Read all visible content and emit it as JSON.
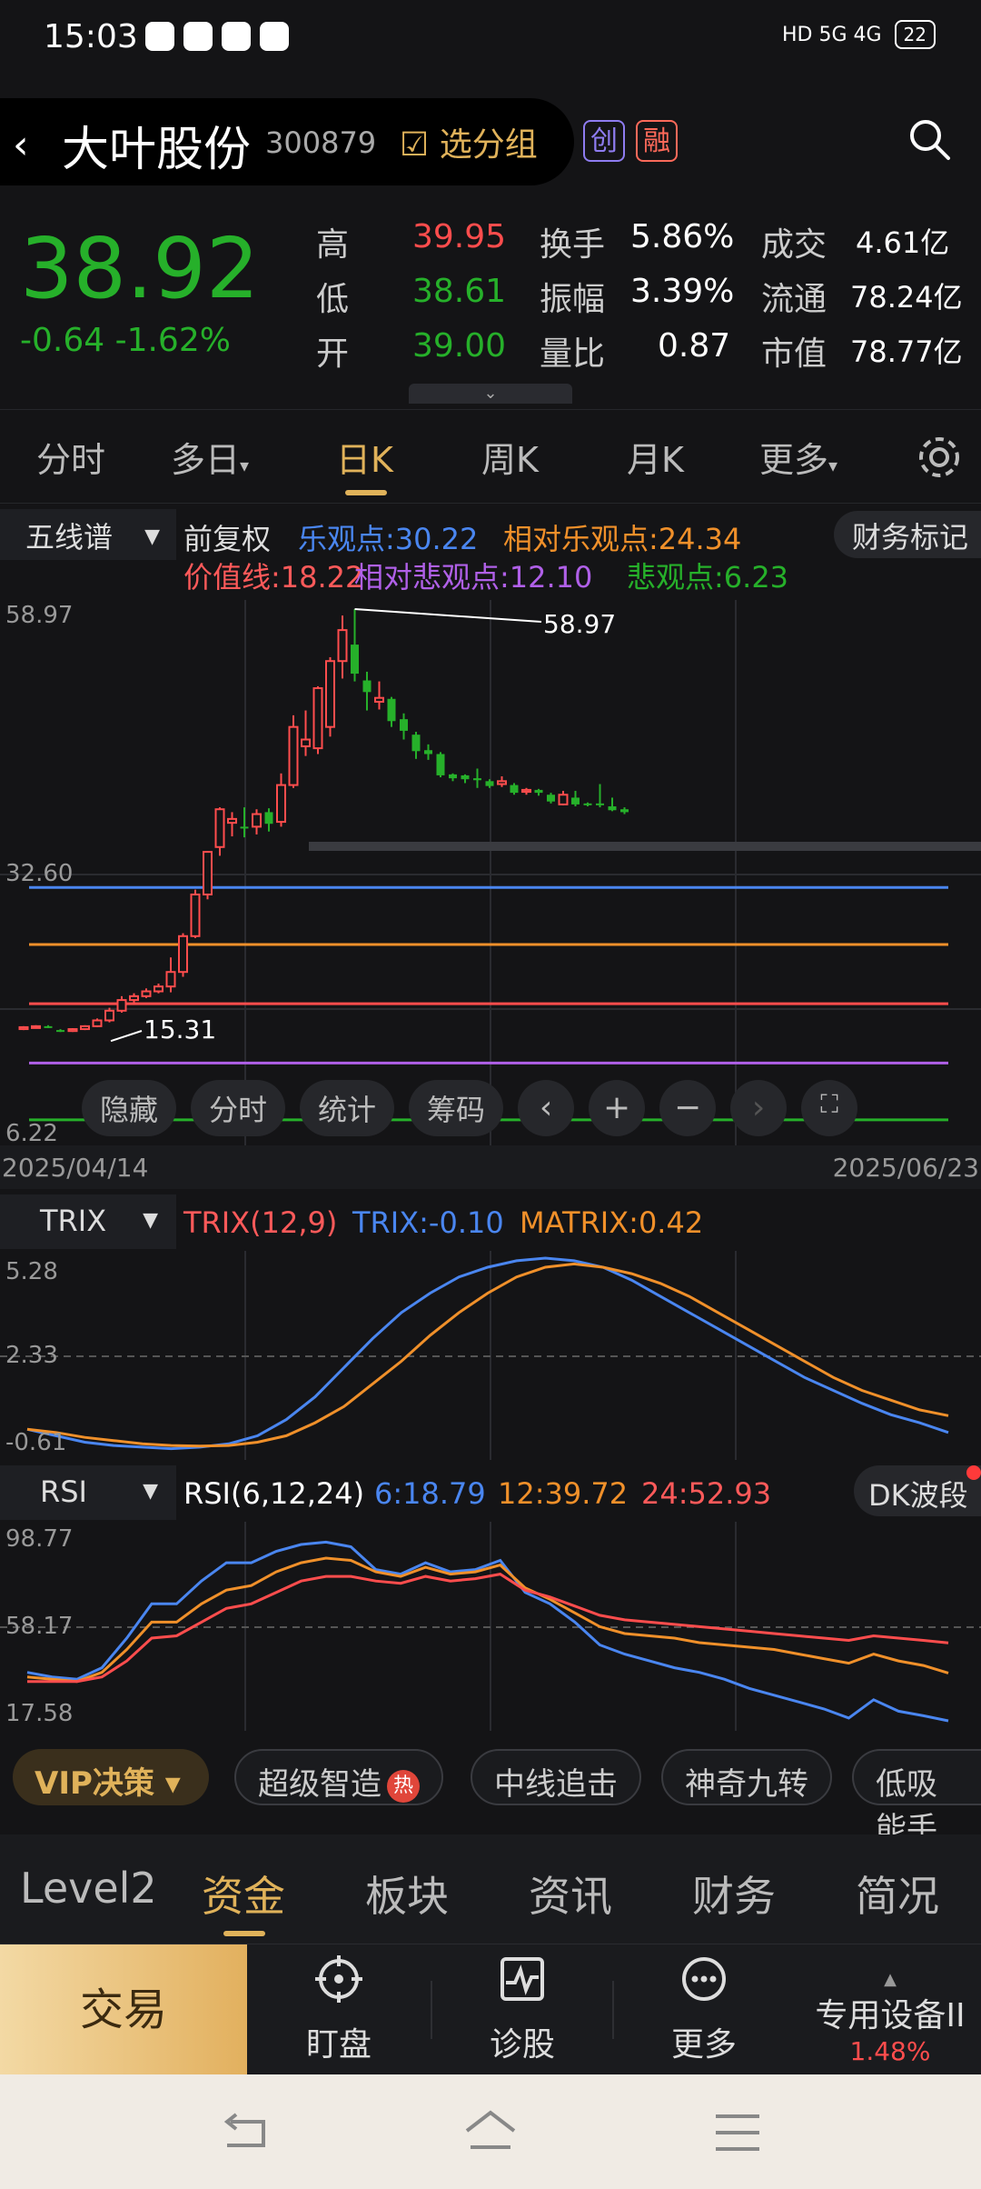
{
  "status_bar": {
    "time": "15:03",
    "network": "HD 5G 4G",
    "battery": "22"
  },
  "header": {
    "stock_name": "大叶股份",
    "stock_code": "300879",
    "select_group_label": "选分组",
    "badge_chuang": "创",
    "badge_rong": "融"
  },
  "quote": {
    "price": "38.92",
    "change": "-0.64 -1.62%",
    "high_label": "高",
    "high": "39.95",
    "low_label": "低",
    "low": "38.61",
    "open_label": "开",
    "open": "39.00",
    "turnover_label": "换手",
    "turnover": "5.86%",
    "amplitude_label": "振幅",
    "amplitude": "3.39%",
    "volume_ratio_label": "量比",
    "volume_ratio": "0.87",
    "deal_label": "成交",
    "deal": "4.61亿",
    "float_label": "流通",
    "float": "78.24亿",
    "mktcap_label": "市值",
    "mktcap": "78.77亿"
  },
  "period_tabs": [
    "分时",
    "多日",
    "日K",
    "周K",
    "月K",
    "更多"
  ],
  "active_period": "日K",
  "kline_header": {
    "indicator": "五线谱",
    "adjust": "前复权",
    "le": "乐观点:30.22",
    "rel_le": "相对乐观点:24.34",
    "value_line": "价值线:18.22",
    "rel_bei": "相对悲观点:12.10",
    "bei": "悲观点:6.23",
    "fin_mark": "财务标记"
  },
  "kline": {
    "y_top": "58.97",
    "y_mid": "32.60",
    "y_bottom": "6.22",
    "max_label": "58.97",
    "min_label": "15.31",
    "tools": [
      "隐藏",
      "分时",
      "统计",
      "筹码"
    ],
    "date_start": "2025/04/14",
    "date_end": "2025/06/23"
  },
  "trix": {
    "indicator": "TRIX",
    "params": "TRIX(12,9)",
    "trix_value": "TRIX:-0.10",
    "matrix_value": "MATRIX:0.42",
    "y_top": "5.28",
    "y_mid": "2.33",
    "y_bottom": "-0.61"
  },
  "rsi": {
    "indicator": "RSI",
    "params": "RSI(6,12,24)",
    "rsi6": "6:18.79",
    "rsi12": "12:39.72",
    "rsi24": "24:52.93",
    "dk_label": "DK波段",
    "y_top": "98.77",
    "y_mid": "58.17",
    "y_bottom": "17.58"
  },
  "vip_row": {
    "vip_label": "VIP决策",
    "chips": [
      "超级智造",
      "中线追击",
      "神奇九转",
      "低吸能手"
    ],
    "hot_label": "热"
  },
  "bottom_tabs": [
    "Level2",
    "资金",
    "板块",
    "资讯",
    "财务",
    "简况"
  ],
  "active_bottom_tab": "资金",
  "action_bar": {
    "trade": "交易",
    "watch": "盯盘",
    "diagnose": "诊股",
    "more": "更多",
    "device": "专用设备II",
    "device_pct": "1.48%"
  },
  "colors": {
    "up": "#ff4d4d",
    "down": "#26b02a",
    "accent": "#e0b25a",
    "blue": "#4a86f0",
    "orange": "#f0902a",
    "purple": "#b060e8"
  },
  "chart_data": {
    "type": "candlestick",
    "ylim": [
      6.22,
      58.97
    ],
    "candles": [
      {
        "o": 15.6,
        "c": 15.8,
        "h": 15.9,
        "l": 15.5
      },
      {
        "o": 15.8,
        "c": 15.9,
        "h": 16.0,
        "l": 15.7
      },
      {
        "o": 15.9,
        "c": 15.8,
        "h": 16.0,
        "l": 15.7
      },
      {
        "o": 15.5,
        "c": 15.4,
        "h": 15.6,
        "l": 15.3
      },
      {
        "o": 15.4,
        "c": 15.6,
        "h": 15.7,
        "l": 15.31
      },
      {
        "o": 15.6,
        "c": 15.9,
        "h": 16.0,
        "l": 15.5
      },
      {
        "o": 15.9,
        "c": 16.5,
        "h": 16.7,
        "l": 15.8
      },
      {
        "o": 16.5,
        "c": 17.5,
        "h": 17.8,
        "l": 16.3
      },
      {
        "o": 17.5,
        "c": 18.6,
        "h": 19.0,
        "l": 17.3
      },
      {
        "o": 18.6,
        "c": 19.0,
        "h": 19.3,
        "l": 18.3
      },
      {
        "o": 19.0,
        "c": 19.5,
        "h": 19.8,
        "l": 18.8
      },
      {
        "o": 19.5,
        "c": 20.0,
        "h": 20.3,
        "l": 19.3
      },
      {
        "o": 20.0,
        "c": 21.5,
        "h": 23.0,
        "l": 19.4
      },
      {
        "o": 21.5,
        "c": 25.2,
        "h": 25.5,
        "l": 21.0
      },
      {
        "o": 25.2,
        "c": 29.5,
        "h": 30.0,
        "l": 25.0
      },
      {
        "o": 29.5,
        "c": 33.9,
        "h": 34.0,
        "l": 29.0
      },
      {
        "o": 34.4,
        "c": 38.3,
        "h": 38.5,
        "l": 33.5
      },
      {
        "o": 36.9,
        "c": 37.3,
        "h": 38.0,
        "l": 35.5
      },
      {
        "o": 36.5,
        "c": 36.4,
        "h": 38.5,
        "l": 35.4
      },
      {
        "o": 36.5,
        "c": 37.8,
        "h": 38.3,
        "l": 35.7
      },
      {
        "o": 38.0,
        "c": 36.8,
        "h": 38.4,
        "l": 36.0
      },
      {
        "o": 37.0,
        "c": 40.8,
        "h": 42.0,
        "l": 36.5
      },
      {
        "o": 40.8,
        "c": 46.8,
        "h": 48.0,
        "l": 40.5
      },
      {
        "o": 44.8,
        "c": 45.5,
        "h": 48.5,
        "l": 43.8
      },
      {
        "o": 44.6,
        "c": 50.8,
        "h": 51.0,
        "l": 44.0
      },
      {
        "o": 46.8,
        "c": 53.6,
        "h": 54.0,
        "l": 45.8
      },
      {
        "o": 53.6,
        "c": 56.8,
        "h": 58.3,
        "l": 51.8
      },
      {
        "o": 55.3,
        "c": 52.3,
        "h": 58.97,
        "l": 51.5
      },
      {
        "o": 51.6,
        "c": 50.4,
        "h": 52.5,
        "l": 48.5
      },
      {
        "o": 49.4,
        "c": 49.8,
        "h": 51.5,
        "l": 48.6
      },
      {
        "o": 49.7,
        "c": 47.4,
        "h": 49.9,
        "l": 46.8
      },
      {
        "o": 47.6,
        "c": 46.4,
        "h": 48.2,
        "l": 45.5
      },
      {
        "o": 46.0,
        "c": 44.3,
        "h": 46.3,
        "l": 43.5
      },
      {
        "o": 44.4,
        "c": 44.0,
        "h": 45.0,
        "l": 43.4
      },
      {
        "o": 44.0,
        "c": 41.8,
        "h": 44.2,
        "l": 41.6
      },
      {
        "o": 41.9,
        "c": 41.5,
        "h": 42.0,
        "l": 41.2
      },
      {
        "o": 41.8,
        "c": 41.4,
        "h": 41.9,
        "l": 41.0
      },
      {
        "o": 41.5,
        "c": 41.3,
        "h": 42.5,
        "l": 40.5
      },
      {
        "o": 41.2,
        "c": 40.7,
        "h": 41.4,
        "l": 40.5
      },
      {
        "o": 40.9,
        "c": 41.2,
        "h": 41.7,
        "l": 40.6
      },
      {
        "o": 40.8,
        "c": 40.0,
        "h": 41.0,
        "l": 39.8
      },
      {
        "o": 40.1,
        "c": 40.3,
        "h": 40.5,
        "l": 39.8
      },
      {
        "o": 40.3,
        "c": 40.0,
        "h": 40.4,
        "l": 39.7
      },
      {
        "o": 39.8,
        "c": 39.1,
        "h": 40.0,
        "l": 38.9
      },
      {
        "o": 38.8,
        "c": 39.8,
        "h": 40.2,
        "l": 38.7
      },
      {
        "o": 39.5,
        "c": 38.8,
        "h": 40.2,
        "l": 38.6
      },
      {
        "o": 38.9,
        "c": 38.8,
        "h": 39.0,
        "l": 38.6
      },
      {
        "o": 38.9,
        "c": 38.8,
        "h": 40.9,
        "l": 38.5
      },
      {
        "o": 38.6,
        "c": 38.2,
        "h": 39.5,
        "l": 38.1
      },
      {
        "o": 38.3,
        "c": 38.0,
        "h": 38.5,
        "l": 37.8
      }
    ],
    "lines": [
      {
        "name": "乐观点",
        "value": 30.22
      },
      {
        "name": "相对乐观点",
        "value": 24.34
      },
      {
        "name": "价值线",
        "value": 18.22
      },
      {
        "name": "相对悲观点",
        "value": 12.1
      },
      {
        "name": "悲观点",
        "value": 6.23
      }
    ],
    "trix_series": {
      "TRIX": [
        0.0,
        -0.2,
        -0.4,
        -0.5,
        -0.55,
        -0.6,
        -0.55,
        -0.45,
        -0.2,
        0.3,
        1.0,
        1.9,
        2.8,
        3.6,
        4.2,
        4.7,
        5.0,
        5.2,
        5.28,
        5.2,
        5.0,
        4.6,
        4.1,
        3.6,
        3.1,
        2.6,
        2.1,
        1.6,
        1.2,
        0.8,
        0.45,
        0.2,
        -0.1
      ],
      "MATRIX": [
        0.0,
        -0.1,
        -0.25,
        -0.35,
        -0.45,
        -0.5,
        -0.52,
        -0.5,
        -0.4,
        -0.2,
        0.2,
        0.7,
        1.4,
        2.1,
        2.9,
        3.6,
        4.2,
        4.7,
        5.0,
        5.1,
        5.0,
        4.8,
        4.5,
        4.1,
        3.6,
        3.1,
        2.6,
        2.1,
        1.6,
        1.2,
        0.9,
        0.6,
        0.42
      ]
    },
    "rsi_series": {
      "RSI6": [
        40,
        38,
        37,
        42,
        55,
        70,
        70,
        80,
        88,
        88,
        93,
        96,
        97,
        95,
        85,
        83,
        88,
        84,
        85,
        89,
        75,
        70,
        62,
        52,
        48,
        45,
        42,
        40,
        37,
        33,
        30,
        27,
        24,
        20,
        28,
        23,
        21,
        18.79
      ],
      "RSI12": [
        38,
        37,
        36,
        40,
        50,
        62,
        62,
        70,
        76,
        78,
        84,
        88,
        90,
        89,
        84,
        82,
        86,
        83,
        84,
        87,
        77,
        72,
        66,
        60,
        57,
        56,
        55,
        53,
        52,
        51,
        50,
        48,
        46,
        44,
        48,
        45,
        43,
        39.72
      ],
      "RSI24": [
        36,
        36,
        36,
        38,
        45,
        55,
        56,
        62,
        68,
        70,
        75,
        80,
        82,
        82,
        80,
        79,
        82,
        80,
        81,
        83,
        76,
        73,
        69,
        65,
        63,
        62,
        61,
        60,
        59,
        58,
        57,
        56,
        55,
        54,
        56,
        55,
        54,
        52.93
      ]
    }
  }
}
